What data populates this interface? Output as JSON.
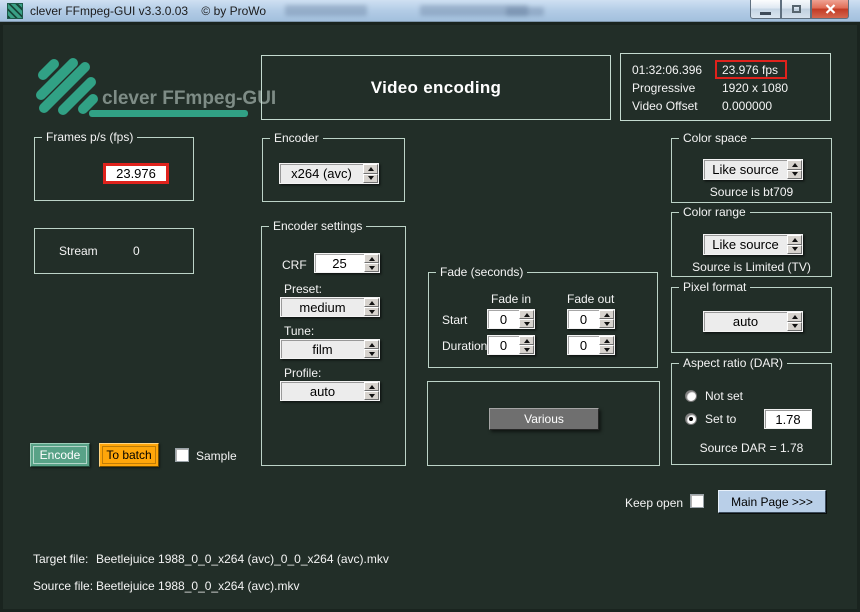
{
  "titlebar": {
    "title": "clever FFmpeg-GUI v3.3.0.03",
    "copyright": "© by ProWo"
  },
  "header": {
    "logo_text": "clever FFmpeg-GUI",
    "page_title": "Video encoding"
  },
  "info_panel": {
    "rows": [
      {
        "label": "01:32:06.396",
        "value": "23.976 fps",
        "highlighted": true
      },
      {
        "label": "Progressive",
        "value": "1920 x 1080",
        "highlighted": false
      },
      {
        "label": "Video Offset",
        "value": "0.000000",
        "highlighted": false
      }
    ]
  },
  "fps_group": {
    "title": "Frames p/s (fps)",
    "value": "23.976"
  },
  "stream_box": {
    "label": "Stream",
    "value": "0"
  },
  "encoder_group": {
    "title": "Encoder",
    "value": "x264 (avc)"
  },
  "encoder_settings": {
    "title": "Encoder settings",
    "crf_label": "CRF",
    "crf_value": "25",
    "preset_label": "Preset:",
    "preset_value": "medium",
    "tune_label": "Tune:",
    "tune_value": "film",
    "profile_label": "Profile:",
    "profile_value": "auto"
  },
  "fade_group": {
    "title": "Fade (seconds)",
    "col_in": "Fade in",
    "col_out": "Fade out",
    "row_start": "Start",
    "row_duration": "Duration",
    "start_in": "0",
    "start_out": "0",
    "duration_in": "0",
    "duration_out": "0"
  },
  "various": {
    "button_label": "Various"
  },
  "color_space": {
    "title": "Color space",
    "value": "Like source",
    "note": "Source is bt709"
  },
  "color_range": {
    "title": "Color range",
    "value": "Like source",
    "note": "Source is Limited (TV)"
  },
  "pixel_format": {
    "title": "Pixel format",
    "value": "auto"
  },
  "aspect_ratio": {
    "title": "Aspect ratio (DAR)",
    "not_set_label": "Not set",
    "set_to_label": "Set to",
    "set_to_value": "1.78",
    "note": "Source DAR = 1.78",
    "selected": "set_to"
  },
  "actions": {
    "encode_label": "Encode",
    "to_batch_label": "To batch",
    "sample_label": "Sample",
    "sample_checked": false,
    "keep_open_label": "Keep open",
    "keep_open_checked": false,
    "main_page_label": "Main Page >>>"
  },
  "files": {
    "target_label": "Target file:",
    "target_value": "Beetlejuice 1988_0_0_x264 (avc)_0_0_x264 (avc).mkv",
    "source_label": "Source file:",
    "source_value": "Beetlejuice 1988_0_0_x264 (avc).mkv"
  },
  "colors": {
    "background": "#222e28",
    "accent_teal": "#31a185",
    "group_border": "#bcd3c7",
    "highlight_red": "#df221c",
    "encode_green": "#58a287",
    "batch_orange": "#ffa60a",
    "various_gray": "#6f6f6f",
    "main_page_blue": "#b9cfe8",
    "titlebar_blue": "#b3cce6"
  }
}
